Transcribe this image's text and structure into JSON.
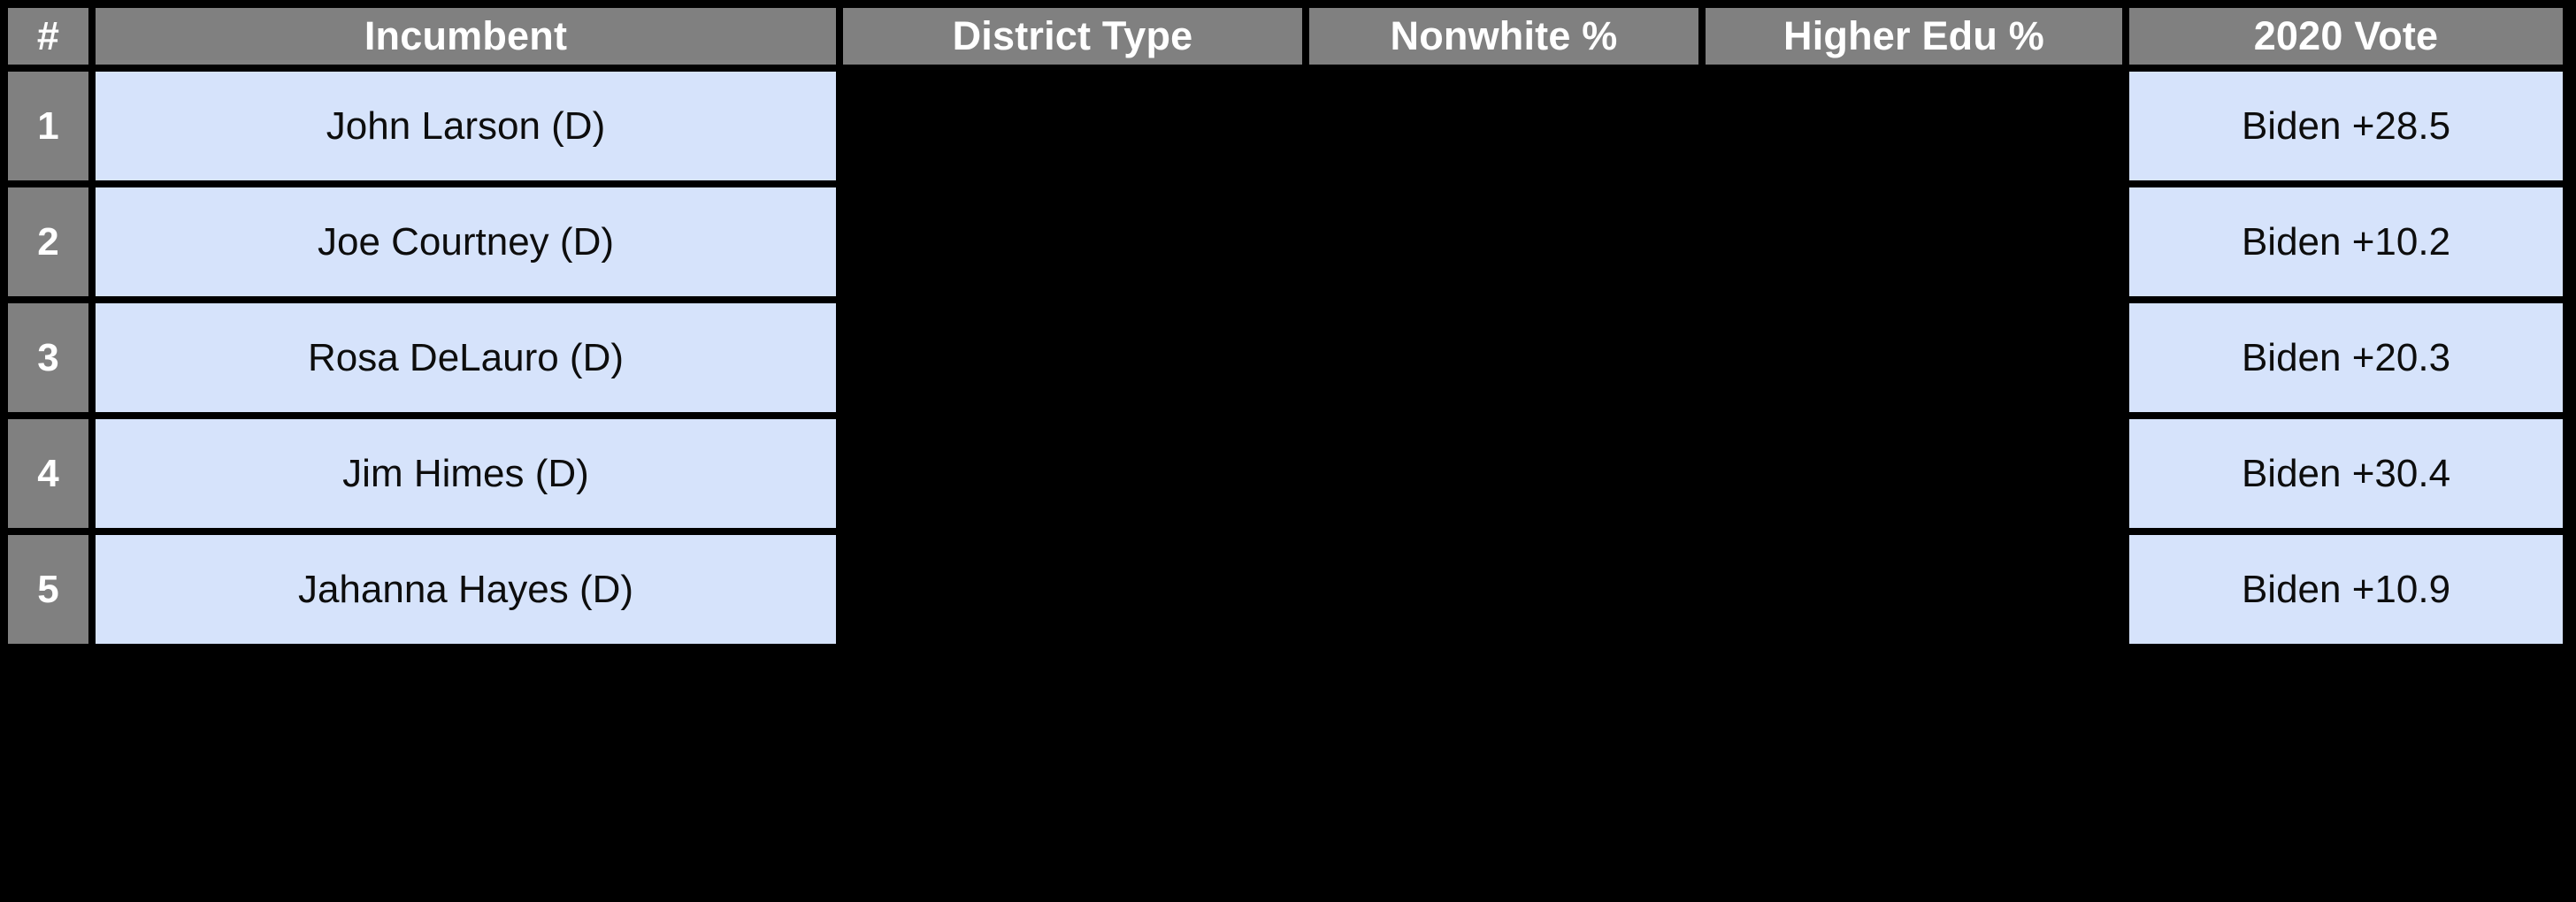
{
  "table": {
    "columns": [
      {
        "key": "num",
        "label": "#",
        "align": "center"
      },
      {
        "key": "incumbent",
        "label": "Incumbent",
        "align": "center"
      },
      {
        "key": "dtype",
        "label": "District Type",
        "align": "center"
      },
      {
        "key": "nonwhite",
        "label": "Nonwhite %",
        "align": "center"
      },
      {
        "key": "hiedu",
        "label": "Higher Edu %",
        "align": "center"
      },
      {
        "key": "vote",
        "label": "2020 Vote",
        "align": "center"
      }
    ],
    "rows": [
      {
        "num": "1",
        "incumbent": "John Larson (D)",
        "dtype": "",
        "nonwhite": "",
        "hiedu": "",
        "vote": "Biden +28.5"
      },
      {
        "num": "2",
        "incumbent": "Joe Courtney (D)",
        "dtype": "",
        "nonwhite": "",
        "hiedu": "",
        "vote": "Biden +10.2"
      },
      {
        "num": "3",
        "incumbent": "Rosa DeLauro (D)",
        "dtype": "",
        "nonwhite": "",
        "hiedu": "",
        "vote": "Biden +20.3"
      },
      {
        "num": "4",
        "incumbent": "Jim Himes (D)",
        "dtype": "",
        "nonwhite": "",
        "hiedu": "",
        "vote": "Biden +30.4"
      },
      {
        "num": "5",
        "incumbent": "Jahanna Hayes (D)",
        "dtype": "",
        "nonwhite": "",
        "hiedu": "",
        "vote": "Biden +10.9"
      }
    ]
  },
  "colors": {
    "background": "#000000",
    "header_fill": "#808080",
    "header_text": "#ffffff",
    "index_fill": "#808080",
    "index_text": "#ffffff",
    "cell_fill": "#d6e3fb",
    "cell_text": "#0d0d0d",
    "gridline": "#000000"
  }
}
